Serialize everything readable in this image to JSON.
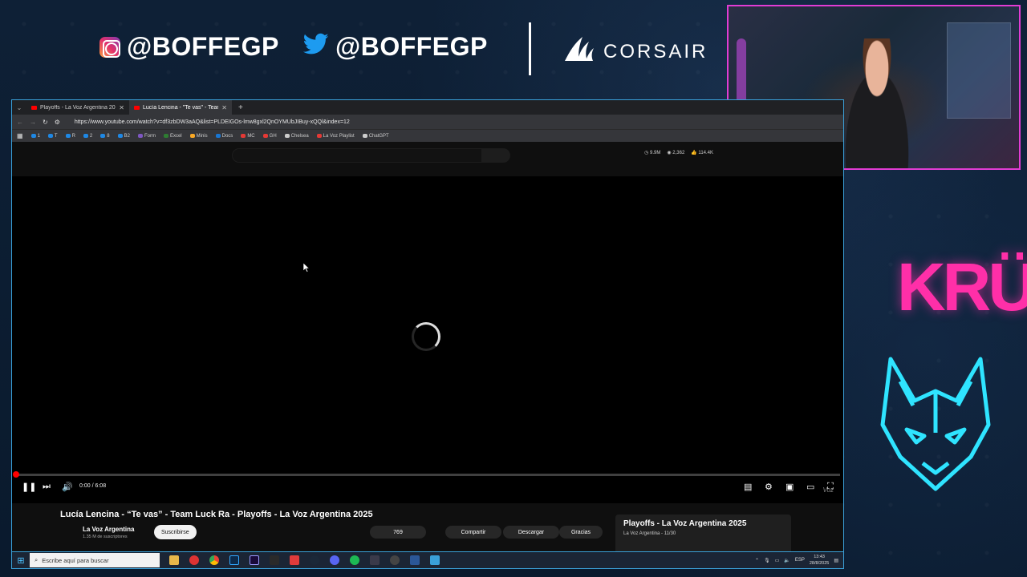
{
  "overlay": {
    "instagram_handle": "@BOFFEGP",
    "twitter_handle": "@BOFFEGP",
    "sponsor_logo_text": "CORSAIR",
    "team_logo_text": "KRÜ",
    "accent_colors": {
      "instagram": "#e1306c",
      "twitter": "#1d9bf0",
      "kru": "#ff2fa8",
      "wolf": "#2fe4ff",
      "webcam_border": "#e23cd4"
    }
  },
  "browser": {
    "tabs": [
      {
        "label": "Playoffs - La Voz Argentina 202",
        "active": false
      },
      {
        "label": "Lucía Lencina - \"Te vas\" - Tean",
        "active": true
      }
    ],
    "url": "https://www.youtube.com/watch?v=df3zbDW3aAQ&list=PLDEIGOs-lmw8gxl2QnOYMUbJIBuy-xQQl&index=12",
    "bookmarks": [
      {
        "label": "1",
        "color": "#1e88e5"
      },
      {
        "label": "T",
        "color": "#1e88e5"
      },
      {
        "label": "R",
        "color": "#1e88e5"
      },
      {
        "label": "2",
        "color": "#1e88e5"
      },
      {
        "label": "8",
        "color": "#1e88e5"
      },
      {
        "label": "B2",
        "color": "#1e88e5"
      },
      {
        "label": "Form",
        "color": "#7e57c2"
      },
      {
        "label": "Excel",
        "color": "#2e7d32"
      },
      {
        "label": "Minis",
        "color": "#f9a825"
      },
      {
        "label": "Docs",
        "color": "#1976d2"
      },
      {
        "label": "MC",
        "color": "#e53935"
      },
      {
        "label": "GH",
        "color": "#e53935"
      },
      {
        "label": "Chelsea",
        "color": "#cccccc"
      },
      {
        "label": "La Voz Playlist",
        "color": "#e53935"
      },
      {
        "label": "ChatGPT",
        "color": "#cccccc"
      }
    ]
  },
  "youtube": {
    "stats": {
      "views": "9.9M",
      "comments": "2,362",
      "likes": "114.4K"
    },
    "player": {
      "time_display": "0:00 / 6:08",
      "progress_fraction": 0.0,
      "state": "loading",
      "watermark": "Voz"
    },
    "video": {
      "title": "Lucía Lencina - “Te vas” - Team Luck Ra - Playoffs - La Voz Argentina 2025",
      "channel": "La Voz Argentina",
      "subscribers": "1.35 M de suscriptores",
      "subscribe_label": "Suscribirse",
      "like_count": "769",
      "share_label": "Compartir",
      "download_label": "Descargar",
      "thanks_label": "Gracias"
    },
    "playlist": {
      "title": "Playoffs - La Voz Argentina 2025",
      "subtitle": "La Voz Argentina - 11/30"
    }
  },
  "taskbar": {
    "search_placeholder": "Escribe aquí para buscar",
    "language": "ESP",
    "time": "13:43",
    "date": "28/8/2025"
  }
}
